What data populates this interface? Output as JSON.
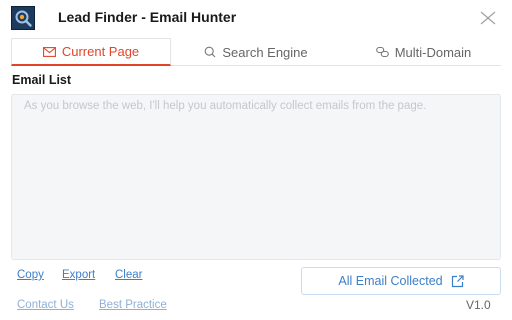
{
  "header": {
    "title": "Lead Finder - Email Hunter",
    "logo_icon": "magnifier-gear-logo-icon",
    "close_icon": "close-icon"
  },
  "tabs": [
    {
      "label": "Current Page",
      "icon": "mail-icon",
      "active": true
    },
    {
      "label": "Search Engine",
      "icon": "search-icon",
      "active": false
    },
    {
      "label": "Multi-Domain",
      "icon": "link-icon",
      "active": false
    }
  ],
  "email_list": {
    "label": "Email List",
    "value": "",
    "placeholder": "As you browse the web, I'll help you automatically collect emails from the page."
  },
  "actions": {
    "copy": "Copy",
    "export": "Export",
    "clear": "Clear",
    "all_collected": "All Email Collected",
    "all_collected_icon": "external-link-icon"
  },
  "footer": {
    "contact": "Contact Us",
    "best_practice": "Best Practice",
    "version": "V1.0"
  },
  "colors": {
    "accent": "#e0452a",
    "link": "#3d7fc8",
    "muted_link": "#8fb1d6",
    "textarea_bg": "#f5f6f8"
  }
}
